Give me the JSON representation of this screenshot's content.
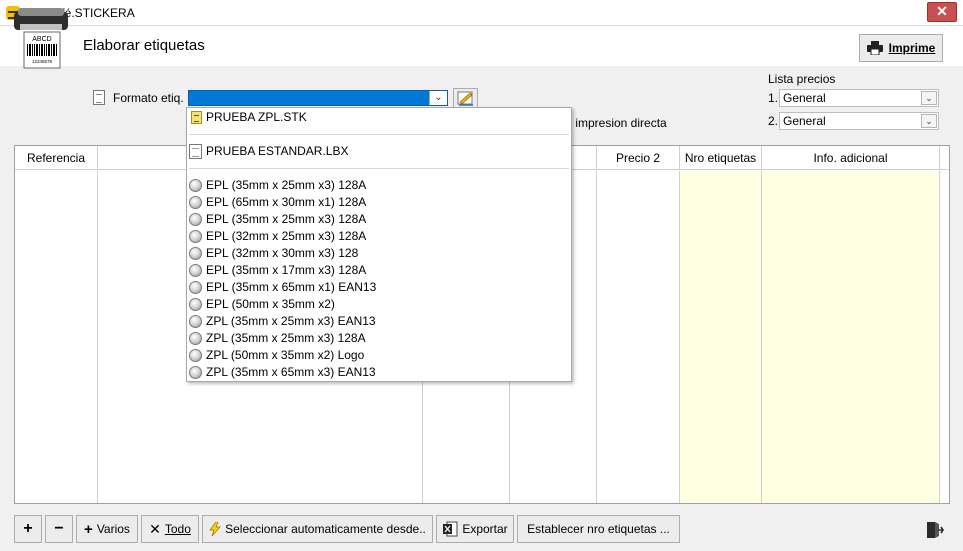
{
  "window": {
    "title": "SysCafé.STICKERA",
    "close_glyph": "✕"
  },
  "header": {
    "title": "Elaborar etiquetas",
    "logo_text": "ABCD",
    "logo_barcode_digits": "12345678",
    "print_button": "Imprime"
  },
  "format": {
    "label": "Formato etiq.",
    "selected_value": "",
    "direct_print_label": "r impresion directa"
  },
  "price_lists": {
    "title": "Lista precios",
    "items": [
      {
        "index": "1.",
        "value": "General"
      },
      {
        "index": "2.",
        "value": "General"
      }
    ]
  },
  "grid": {
    "columns": [
      "Referencia",
      "",
      "",
      "",
      "Precio 2",
      "Nro etiquetas",
      "Info. adicional"
    ]
  },
  "dropdown": {
    "groups": [
      {
        "type": "stk",
        "items": [
          "PRUEBA ZPL.STK"
        ]
      },
      {
        "type": "lbx",
        "items": [
          "PRUEBA ESTANDAR.LBX"
        ]
      },
      {
        "type": "builtin",
        "items": [
          "EPL (35mm x 25mm x3) 128A",
          "EPL (65mm x 30mm x1) 128A",
          "EPL (35mm x 25mm x3) 128A",
          "EPL (32mm x 25mm x3) 128A",
          "EPL (32mm x 30mm x3) 128",
          "EPL (35mm x 17mm x3) 128A",
          "EPL (35mm x 65mm x1) EAN13",
          "EPL (50mm x 35mm x2)",
          "ZPL (35mm x 25mm x3) EAN13",
          "ZPL (35mm x 25mm x3) 128A",
          "ZPL (50mm x 35mm x2) Logo",
          "ZPL (35mm x 65mm x3) EAN13"
        ]
      }
    ]
  },
  "toolbar": {
    "add_glyph": "+",
    "remove_glyph": "−",
    "varios_label": "Varios",
    "todo_label": "Todo",
    "auto_select_label": "Seleccionar automaticamente desde..",
    "export_label": "Exportar",
    "set_count_label": "Establecer nro etiquetas ..."
  },
  "colors": {
    "selection": "#0078d7",
    "close": "#c75050",
    "grid_highlight": "#ffffe1"
  }
}
